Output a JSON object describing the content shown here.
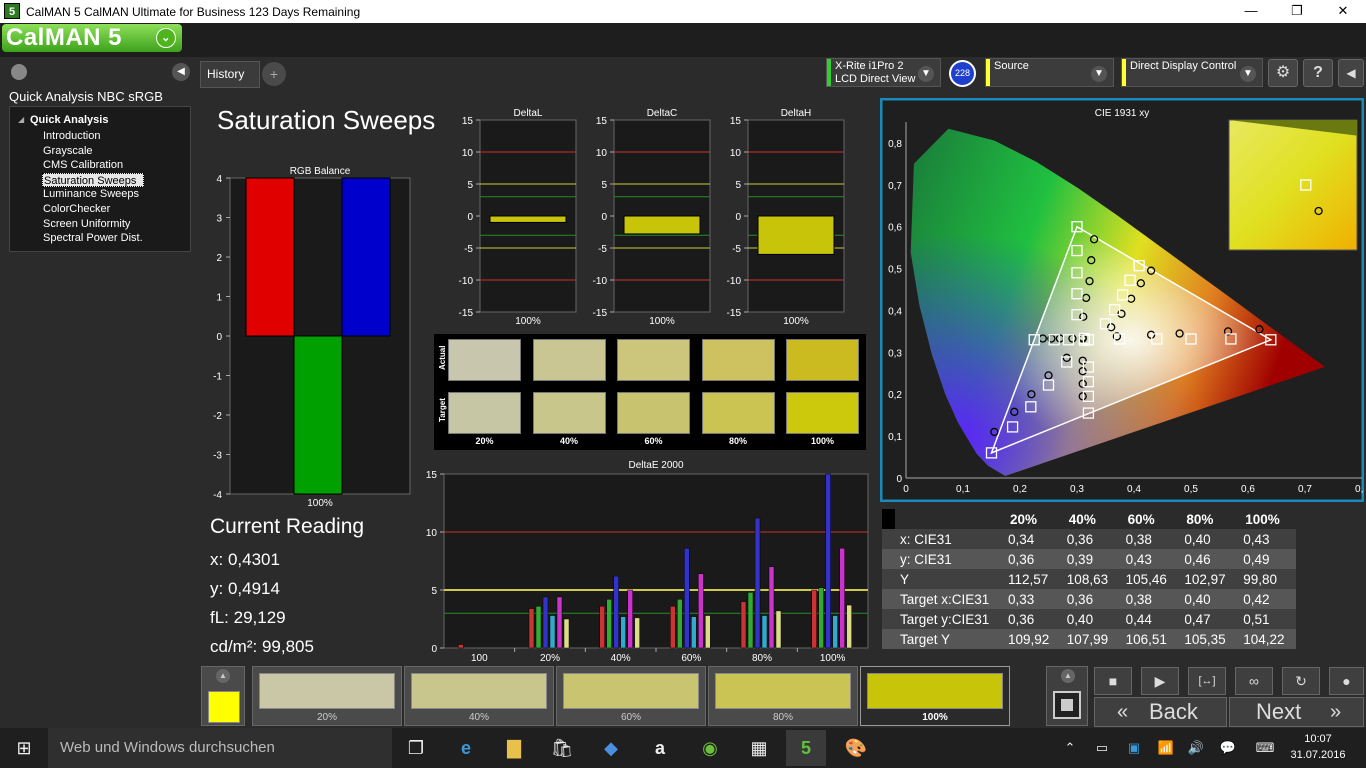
{
  "window": {
    "title": "CalMAN 5 CalMAN Ultimate for Business 123 Days Remaining",
    "icon_text": "5",
    "minimize": "—",
    "maximize": "❐",
    "close": "✕"
  },
  "logo": {
    "text": "CalMAN 5",
    "chevron": "⌄"
  },
  "sidebar": {
    "title": "Quick Analysis NBC sRGB",
    "tree_root": "Quick Analysis",
    "items": [
      "Introduction",
      "Grayscale",
      "CMS Calibration",
      "Saturation Sweeps",
      "Luminance Sweeps",
      "ColorChecker",
      "Screen Uniformity",
      "Spectral Power Dist."
    ],
    "selected_index": 3,
    "collapse_arrow": "◀"
  },
  "tabs": {
    "history": "History 1",
    "add": "+"
  },
  "devices": {
    "meter_line1": "X-Rite i1Pro 2",
    "meter_line2": "LCD Direct View",
    "meter_badge": "228",
    "source": "Source",
    "display": "Direct Display Control",
    "colors": {
      "meter": "#33cc33",
      "source": "#ffff33",
      "display": "#ffff33",
      "badge": "#1f3fcf"
    }
  },
  "toolbar_icons": [
    "gear-icon",
    "help-icon",
    "collapse-icon"
  ],
  "page_title": "Saturation Sweeps",
  "chart_data": [
    {
      "type": "bar",
      "title": "RGB Balance",
      "categories": [
        "100%"
      ],
      "series": [
        {
          "values": [
            4
          ]
        },
        {
          "values": [
            -4
          ]
        },
        {
          "values": [
            4
          ]
        }
      ],
      "colors": [
        "#e00000",
        "#00a000",
        "#0000cc"
      ],
      "ylim": [
        -4,
        4
      ],
      "yticks": [
        "4",
        "3",
        "2",
        "1",
        "0",
        "-1",
        "-2",
        "-3",
        "-4"
      ]
    },
    {
      "type": "bar",
      "title": "DeltaL",
      "categories": [
        "100%"
      ],
      "values": [
        -1
      ],
      "ylim": [
        -15,
        15
      ],
      "yticks": [
        "15",
        "10",
        "5",
        "0",
        "-5",
        "-10",
        "-15"
      ]
    },
    {
      "type": "bar",
      "title": "DeltaC",
      "categories": [
        "100%"
      ],
      "values": [
        -2.8
      ],
      "ylim": [
        -15,
        15
      ],
      "yticks": [
        "15",
        "10",
        "5",
        "0",
        "-5",
        "-10",
        "-15"
      ]
    },
    {
      "type": "bar",
      "title": "DeltaH",
      "categories": [
        "100%"
      ],
      "values": [
        -6
      ],
      "ylim": [
        -15,
        15
      ],
      "yticks": [
        "15",
        "10",
        "5",
        "0",
        "-5",
        "-10",
        "-15"
      ]
    },
    {
      "type": "bar",
      "title": "DeltaE 2000",
      "categories": [
        "100",
        "20%",
        "40%",
        "60%",
        "80%",
        "100%"
      ],
      "series": [
        {
          "values": [
            0.3,
            3.4,
            3.6,
            3.6,
            4.0,
            5.0
          ],
          "color": "#cc3333"
        },
        {
          "values": [
            0,
            3.6,
            4.2,
            4.2,
            4.8,
            5.2
          ],
          "color": "#33aa33"
        },
        {
          "values": [
            0,
            4.4,
            6.2,
            8.6,
            11.2,
            15.0
          ],
          "color": "#3333cc"
        },
        {
          "values": [
            0,
            2.8,
            2.7,
            2.7,
            2.8,
            2.8
          ],
          "color": "#33aacc"
        },
        {
          "values": [
            0,
            4.4,
            5.0,
            6.4,
            7.0,
            8.6
          ],
          "color": "#cc33cc"
        },
        {
          "values": [
            0,
            2.5,
            2.6,
            2.8,
            3.2,
            3.7
          ],
          "color": "#dddd88"
        }
      ],
      "ylim": [
        0,
        15
      ],
      "yticks": [
        "15",
        "10",
        "5",
        "0"
      ]
    },
    {
      "type": "scatter",
      "title": "CIE 1931 xy",
      "xlim": [
        0,
        0.8
      ],
      "ylim": [
        0,
        0.85
      ],
      "xticks": [
        "0",
        "0,1",
        "0,2",
        "0,3",
        "0,4",
        "0,5",
        "0,6",
        "0,7",
        "0,8"
      ],
      "yticks": [
        "0",
        "0,1",
        "0,2",
        "0,3",
        "0,4",
        "0,5",
        "0,6",
        "0,7",
        "0,8"
      ],
      "gamut": {
        "x": [
          0.64,
          0.3,
          0.15
        ],
        "y": [
          0.33,
          0.6,
          0.06
        ]
      },
      "targets": {
        "x": [
          0.64,
          0.57,
          0.5,
          0.44,
          0.375,
          0.3,
          0.3,
          0.3,
          0.3,
          0.3,
          0.15,
          0.187,
          0.219,
          0.25,
          0.282,
          0.225,
          0.26,
          0.285,
          0.32,
          0.32,
          0.32,
          0.32,
          0.32,
          0.409,
          0.393,
          0.38,
          0.366,
          0.35,
          0.313,
          0.313
        ],
        "y": [
          0.33,
          0.332,
          0.332,
          0.332,
          0.332,
          0.6,
          0.543,
          0.49,
          0.44,
          0.39,
          0.06,
          0.122,
          0.17,
          0.222,
          0.277,
          0.33,
          0.33,
          0.33,
          0.33,
          0.155,
          0.195,
          0.23,
          0.265,
          0.507,
          0.472,
          0.437,
          0.402,
          0.368,
          0.333,
          0.329
        ]
      },
      "measured": {
        "x": [
          0.62,
          0.565,
          0.48,
          0.43,
          0.37,
          0.33,
          0.325,
          0.322,
          0.316,
          0.311,
          0.155,
          0.19,
          0.22,
          0.25,
          0.282,
          0.24,
          0.255,
          0.27,
          0.292,
          0.31,
          0.31,
          0.31,
          0.31,
          0.43,
          0.412,
          0.395,
          0.378,
          0.36,
          0.31,
          0.31
        ],
        "y": [
          0.355,
          0.35,
          0.345,
          0.342,
          0.338,
          0.57,
          0.52,
          0.47,
          0.43,
          0.385,
          0.11,
          0.158,
          0.2,
          0.245,
          0.287,
          0.333,
          0.333,
          0.333,
          0.333,
          0.195,
          0.225,
          0.255,
          0.28,
          0.495,
          0.465,
          0.428,
          0.392,
          0.36,
          0.333,
          0.335
        ]
      },
      "inset": {
        "target": {
          "x": 0.42,
          "y": 0.51
        },
        "measured": {
          "x": 0.43,
          "y": 0.49
        }
      }
    }
  ],
  "current_reading": {
    "heading": "Current Reading",
    "x": "x: 0,4301",
    "y": "y: 0,4914",
    "fl": "fL: 29,129",
    "cd": "cd/m²: 99,805"
  },
  "swatches": {
    "row_labels": [
      "Actual",
      "Target"
    ],
    "labels": [
      "20%",
      "40%",
      "60%",
      "80%",
      "100%"
    ],
    "actual": [
      "#c8c6ac",
      "#cac694",
      "#ccc57c",
      "#cdc25f",
      "#cbba20"
    ],
    "target": [
      "#c6c6a4",
      "#c8c68a",
      "#c8c36e",
      "#cbc453",
      "#ccc80c"
    ]
  },
  "table": {
    "headers": [
      "",
      "20%",
      "40%",
      "60%",
      "80%",
      "100%"
    ],
    "rows": [
      [
        "x: CIE31",
        "0,34",
        "0,36",
        "0,38",
        "0,40",
        "0,43"
      ],
      [
        "y: CIE31",
        "0,36",
        "0,39",
        "0,43",
        "0,46",
        "0,49"
      ],
      [
        "Y",
        "112,57",
        "108,63",
        "105,46",
        "102,97",
        "99,80"
      ],
      [
        "Target x:CIE31",
        "0,33",
        "0,36",
        "0,38",
        "0,40",
        "0,42"
      ],
      [
        "Target y:CIE31",
        "0,36",
        "0,40",
        "0,44",
        "0,47",
        "0,51"
      ],
      [
        "Target Y",
        "109,92",
        "107,99",
        "106,51",
        "105,35",
        "104,22"
      ]
    ]
  },
  "bottom": {
    "current_color": "#ffff00",
    "patches": [
      {
        "label": "20%",
        "color": "#c9c7a6"
      },
      {
        "label": "40%",
        "color": "#c9c68d"
      },
      {
        "label": "60%",
        "color": "#c9c470"
      },
      {
        "label": "80%",
        "color": "#cac455"
      },
      {
        "label": "100%",
        "color": "#c8c40a"
      }
    ],
    "back": "Back",
    "next": "Next",
    "back_arrow": "«",
    "next_arrow": "»",
    "controls": [
      "■",
      "▶",
      "[↔]",
      "∞",
      "↻"
    ]
  },
  "taskbar": {
    "search_placeholder": "Web und Windows durchsuchen",
    "time": "10:07",
    "date": "31.07.2016"
  }
}
